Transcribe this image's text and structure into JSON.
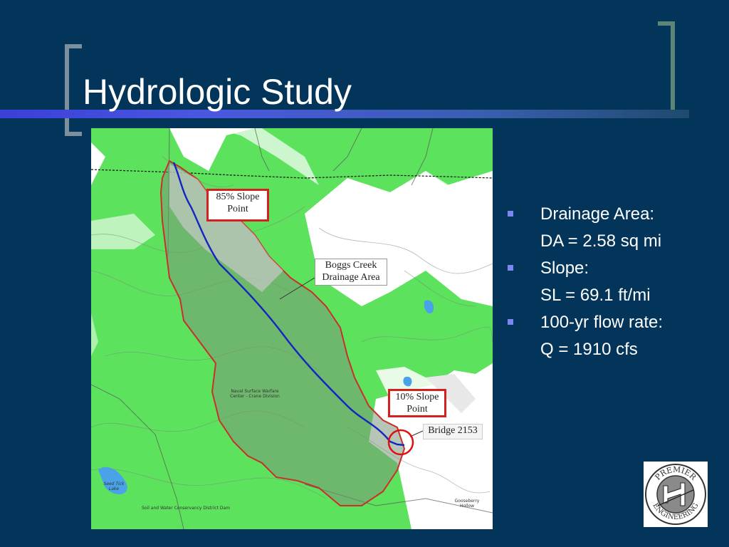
{
  "slide": {
    "title": "Hydrologic Study"
  },
  "map": {
    "labels": {
      "slope_85_line1": "85% Slope",
      "slope_85_line2": "Point",
      "slope_10_line1": "10% Slope",
      "slope_10_line2": "Point",
      "boggs_line1": "Boggs Creek",
      "boggs_line2": "Drainage Area",
      "bridge": "Bridge 2153",
      "naval_line1": "Naval Surface Warfare",
      "naval_line2": "Center - Crane Division",
      "seed_tick_line1": "Seed Tick",
      "seed_tick_line2": "Lake",
      "dam": "Soil and Water Conservancy District Dam",
      "gooseberry_line1": "Gooseberry",
      "gooseberry_line2": "Hollow"
    },
    "colors": {
      "vegetation": "#5de25d",
      "drainage_boundary": "#c8302a",
      "stream": "#1525c0",
      "water": "#4aa3e8",
      "callout_border": "#d42020"
    }
  },
  "bullets": [
    {
      "label": "Drainage Area:",
      "value": "DA = 2.58 sq mi"
    },
    {
      "label": "Slope:",
      "value": "SL = 69.1 ft/mi"
    },
    {
      "label": "100-yr flow rate:",
      "value": "Q = 1910 cfs"
    }
  ],
  "logo": {
    "text_top": "PREMIER",
    "text_bottom": "ENGINEERING",
    "icon": "premier-engineering-seal-icon"
  },
  "colors": {
    "background": "#033459",
    "title_bar": "#3b3fd8",
    "bullet": "#7b86f0"
  }
}
